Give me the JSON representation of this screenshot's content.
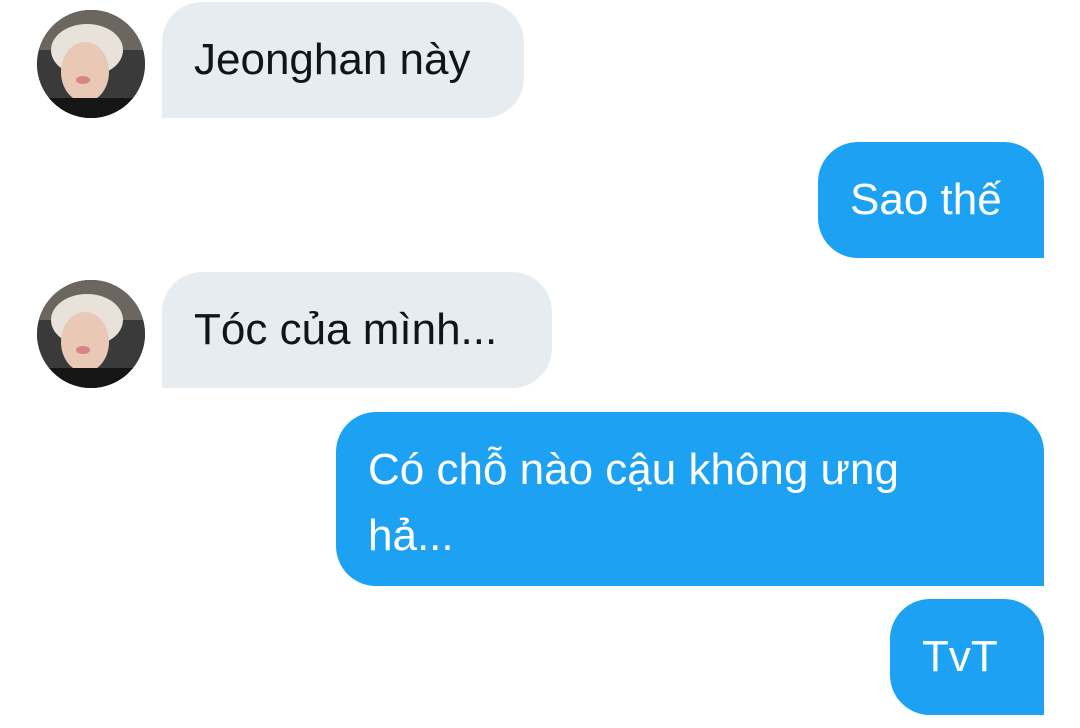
{
  "messages": [
    {
      "direction": "incoming",
      "text": "Jeonghan này",
      "avatar": "avatar-photo"
    },
    {
      "direction": "outgoing",
      "text": "Sao thế"
    },
    {
      "direction": "incoming",
      "text": "Tóc của mình...",
      "avatar": "avatar-photo"
    },
    {
      "direction": "outgoing",
      "text": "Có chỗ nào cậu không ưng hả..."
    },
    {
      "direction": "outgoing",
      "text": "TvT"
    }
  ],
  "colors": {
    "incoming_bubble": "#e6ecf0",
    "outgoing_bubble": "#1da1f2",
    "incoming_text": "#111418",
    "outgoing_text": "#ffffff"
  }
}
